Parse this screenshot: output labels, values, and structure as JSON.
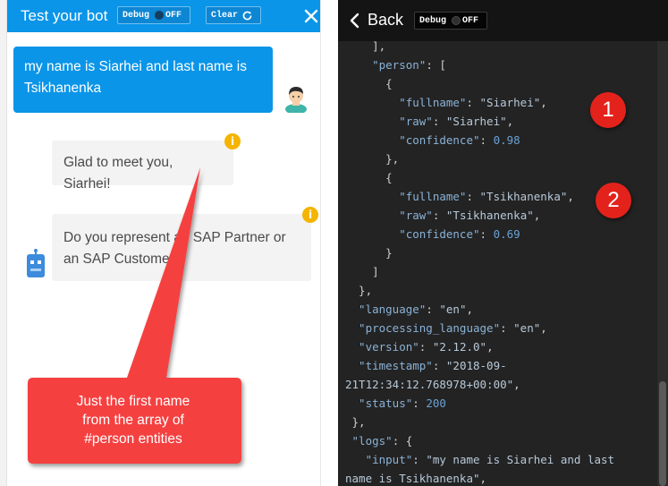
{
  "chat": {
    "title": "Test your bot",
    "debug_label": "Debug",
    "debug_state": "OFF",
    "clear_label": "Clear",
    "messages": {
      "user": "my name is Siarhei and last name is Tsikhanenka",
      "bot_1": "Glad to meet you, Siarhei!",
      "bot_2": "Do you represent an SAP Partner or an SAP Customer?"
    },
    "info_glyph": "i"
  },
  "callout": {
    "line_1": "Just the first name",
    "line_2": "from the array of",
    "line_3": "#person entities",
    "color": "#f5413f"
  },
  "debug_panel": {
    "back_label": "Back",
    "debug_label": "Debug",
    "debug_state": "OFF",
    "json_lines": [
      [
        {
          "t": "p",
          "v": "    ],"
        }
      ],
      [
        {
          "t": "k",
          "v": "    \"person\""
        },
        {
          "t": "p",
          "v": ": ["
        }
      ],
      [
        {
          "t": "p",
          "v": "      {"
        }
      ],
      [
        {
          "t": "k",
          "v": "        \"fullname\""
        },
        {
          "t": "p",
          "v": ": "
        },
        {
          "t": "s",
          "v": "\"Siarhei\""
        },
        {
          "t": "p",
          "v": ","
        }
      ],
      [
        {
          "t": "k",
          "v": "        \"raw\""
        },
        {
          "t": "p",
          "v": ": "
        },
        {
          "t": "s",
          "v": "\"Siarhei\""
        },
        {
          "t": "p",
          "v": ","
        }
      ],
      [
        {
          "t": "k",
          "v": "        \"confidence\""
        },
        {
          "t": "p",
          "v": ": "
        },
        {
          "t": "n",
          "v": "0.98"
        }
      ],
      [
        {
          "t": "p",
          "v": "      },"
        }
      ],
      [
        {
          "t": "p",
          "v": "      {"
        }
      ],
      [
        {
          "t": "k",
          "v": "        \"fullname\""
        },
        {
          "t": "p",
          "v": ": "
        },
        {
          "t": "s",
          "v": "\"Tsikhanenka\""
        },
        {
          "t": "p",
          "v": ","
        }
      ],
      [
        {
          "t": "k",
          "v": "        \"raw\""
        },
        {
          "t": "p",
          "v": ": "
        },
        {
          "t": "s",
          "v": "\"Tsikhanenka\""
        },
        {
          "t": "p",
          "v": ","
        }
      ],
      [
        {
          "t": "k",
          "v": "        \"confidence\""
        },
        {
          "t": "p",
          "v": ": "
        },
        {
          "t": "n",
          "v": "0.69"
        }
      ],
      [
        {
          "t": "p",
          "v": "      }"
        }
      ],
      [
        {
          "t": "p",
          "v": "    ]"
        }
      ],
      [
        {
          "t": "p",
          "v": "  },"
        }
      ],
      [
        {
          "t": "k",
          "v": "  \"language\""
        },
        {
          "t": "p",
          "v": ": "
        },
        {
          "t": "s",
          "v": "\"en\""
        },
        {
          "t": "p",
          "v": ","
        }
      ],
      [
        {
          "t": "k",
          "v": "  \"processing_language\""
        },
        {
          "t": "p",
          "v": ": "
        },
        {
          "t": "s",
          "v": "\"en\""
        },
        {
          "t": "p",
          "v": ","
        }
      ],
      [
        {
          "t": "k",
          "v": "  \"version\""
        },
        {
          "t": "p",
          "v": ": "
        },
        {
          "t": "s",
          "v": "\"2.12.0\""
        },
        {
          "t": "p",
          "v": ","
        }
      ],
      [
        {
          "t": "k",
          "v": "  \"timestamp\""
        },
        {
          "t": "p",
          "v": ": "
        },
        {
          "t": "s",
          "v": "\"2018-09-"
        }
      ],
      [
        {
          "t": "s",
          "v": "21T12:34:12.768978+00:00\""
        },
        {
          "t": "p",
          "v": ","
        }
      ],
      [
        {
          "t": "k",
          "v": "  \"status\""
        },
        {
          "t": "p",
          "v": ": "
        },
        {
          "t": "n",
          "v": "200"
        }
      ],
      [
        {
          "t": "p",
          "v": " },"
        }
      ],
      [
        {
          "t": "k",
          "v": " \"logs\""
        },
        {
          "t": "p",
          "v": ": {"
        }
      ],
      [
        {
          "t": "k",
          "v": "   \"input\""
        },
        {
          "t": "p",
          "v": ": "
        },
        {
          "t": "s",
          "v": "\"my name is Siarhei and last"
        }
      ],
      [
        {
          "t": "s",
          "v": "name is Tsikhanenka\""
        },
        {
          "t": "p",
          "v": ","
        }
      ]
    ]
  },
  "badges": [
    "1",
    "2"
  ],
  "icons": {
    "close": "close-icon",
    "refresh": "refresh-icon",
    "back": "chevron-left-icon",
    "info": "info-icon"
  },
  "colors": {
    "chat_header": "#0a95e8",
    "debug_bg": "#232323",
    "badge": "#e3221c",
    "info": "#f4b400"
  }
}
